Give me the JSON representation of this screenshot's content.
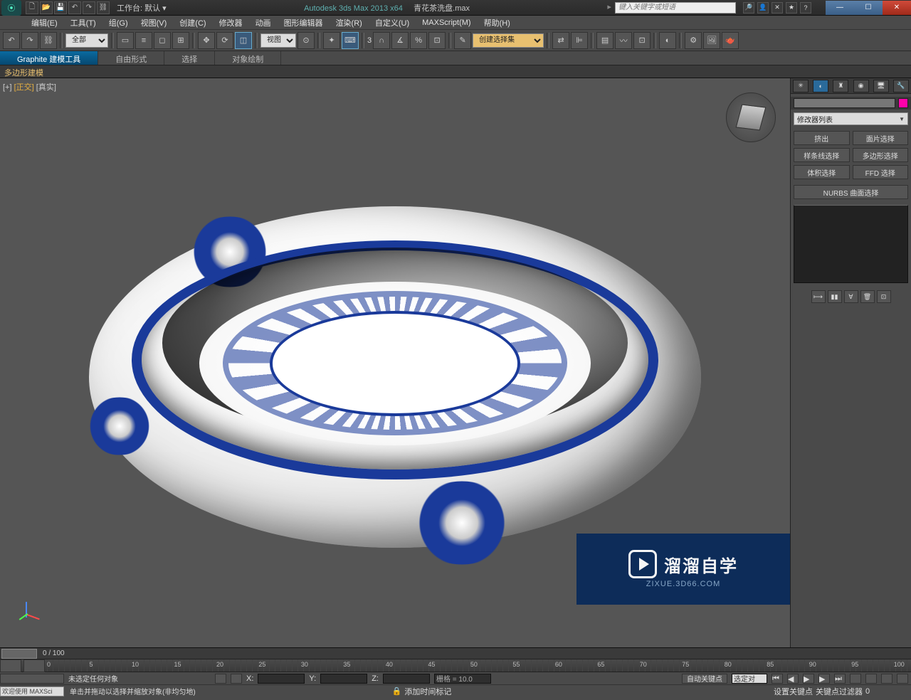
{
  "title": {
    "app": "Autodesk 3ds Max  2013 x64",
    "file": "青花茶洗盘.max",
    "workspace_prefix": "工作台:",
    "workspace_value": "默认",
    "search_placeholder": "键入关键字或短语"
  },
  "window_controls": {
    "min": "—",
    "max": "☐",
    "close": "✕"
  },
  "menu": [
    "编辑(E)",
    "工具(T)",
    "组(G)",
    "视图(V)",
    "创建(C)",
    "修改器",
    "动画",
    "图形编辑器",
    "渲染(R)",
    "自定义(U)",
    "MAXScript(M)",
    "帮助(H)"
  ],
  "toolbar": {
    "filter": "全部",
    "coord_sys": "视图",
    "named_set": "创建选择集",
    "label3": "3"
  },
  "ribbon": {
    "tabs": [
      "Graphite 建模工具",
      "自由形式",
      "选择",
      "对象绘制"
    ],
    "active": 0,
    "sub": "多边形建模"
  },
  "viewport": {
    "labels": [
      "[+]",
      "[正交]",
      "[真实]"
    ]
  },
  "command_panel": {
    "modifier_list": "修改器列表",
    "buttons": [
      "挤出",
      "面片选择",
      "样条线选择",
      "多边形选择",
      "体积选择",
      "FFD 选择"
    ],
    "wide": "NURBS 曲面选择"
  },
  "time": {
    "frame_label": "0 / 100",
    "ticks": [
      "0",
      "5",
      "10",
      "15",
      "20",
      "25",
      "30",
      "35",
      "40",
      "45",
      "50",
      "55",
      "60",
      "65",
      "70",
      "75",
      "80",
      "85",
      "90",
      "95",
      "100"
    ]
  },
  "status": {
    "sel_hint": "未选定任何对象",
    "x": "X:",
    "y": "Y:",
    "z": "Z:",
    "grid": "栅格 = 10.0",
    "autokey": "自动关键点",
    "selected": "选定对",
    "setkey": "设置关键点",
    "keyfilter": "关键点过滤器"
  },
  "status2": {
    "welcome": "欢迎使用  MAXSci",
    "hint": "单击并拖动以选择并缩放对象(非均匀地)",
    "lock_icon": "🔒",
    "addtag": "添加时间标记"
  },
  "watermark": {
    "brand": "溜溜自学",
    "url": "ZIXUE.3D66.COM"
  }
}
